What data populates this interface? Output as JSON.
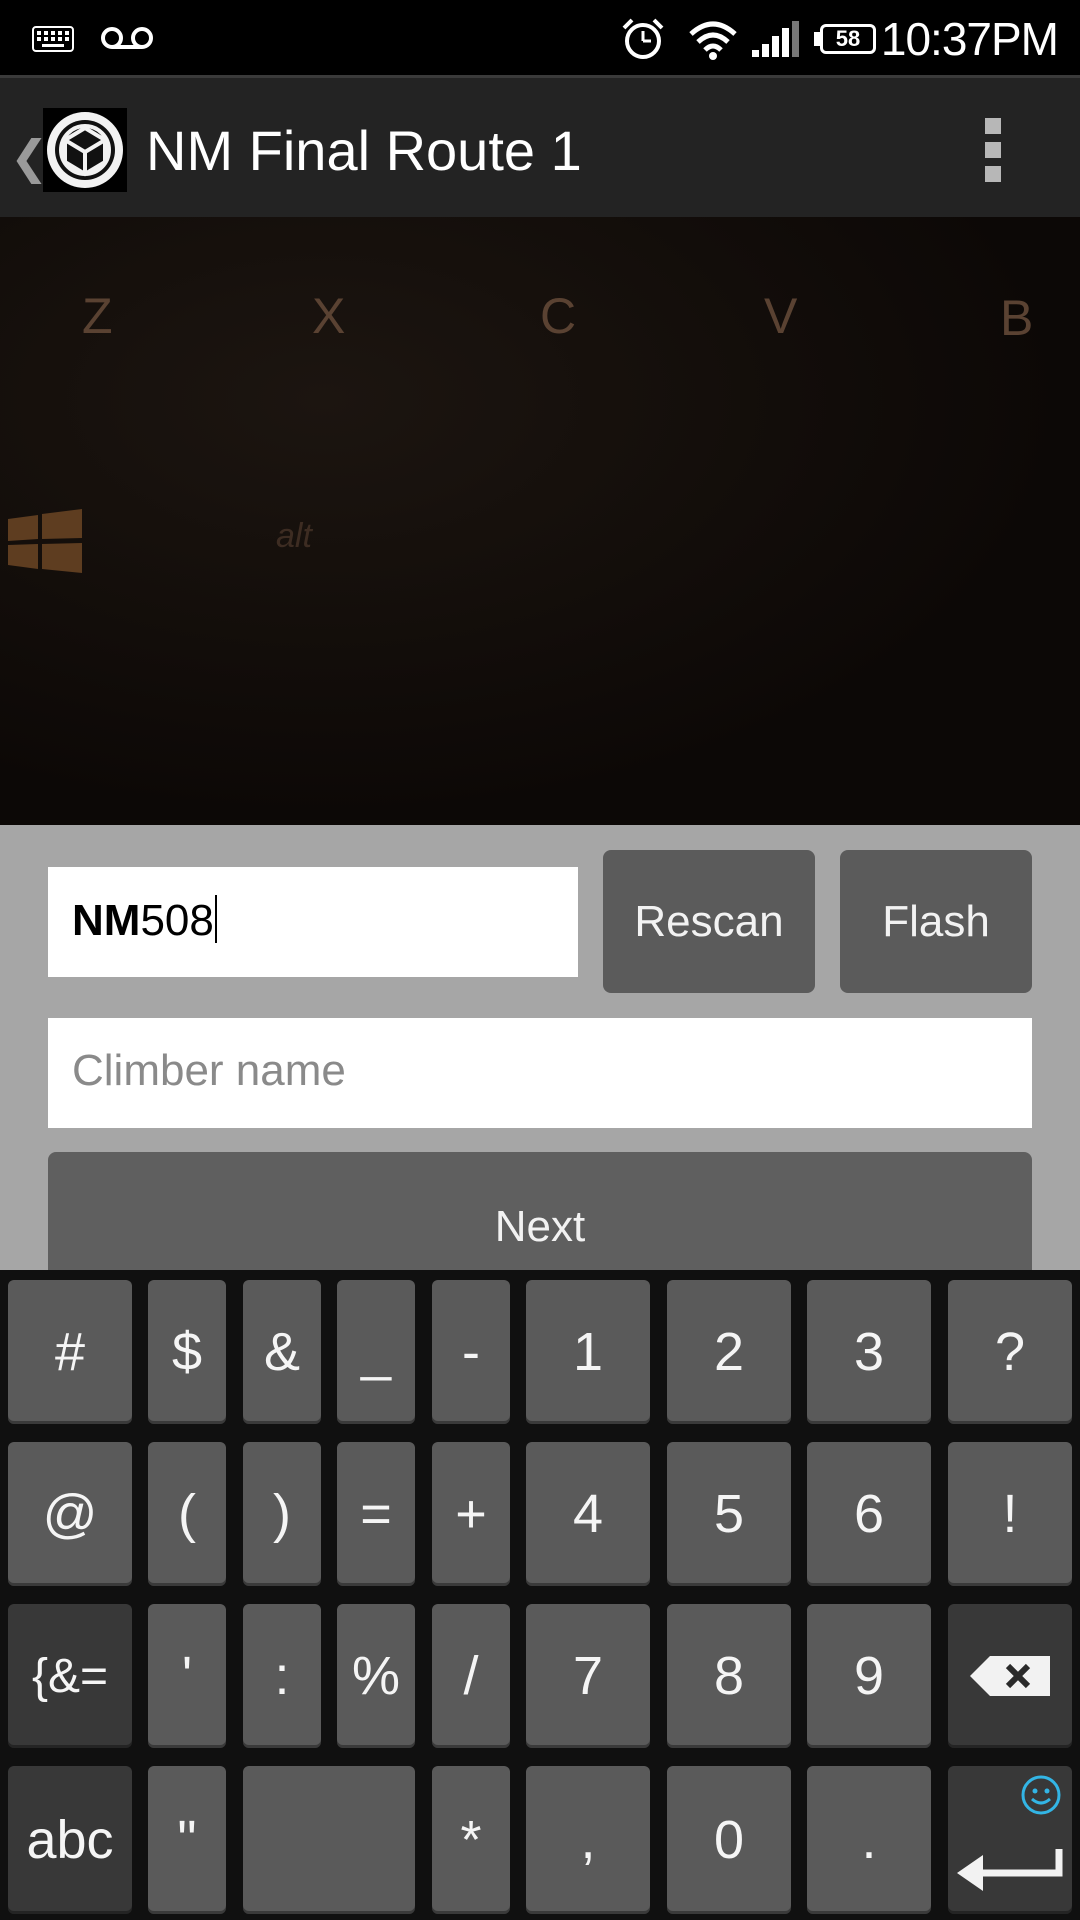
{
  "status_bar": {
    "time": "10:37PM",
    "battery_level": "58",
    "icons": [
      "keyboard-icon",
      "voicemail-icon",
      "alarm-icon",
      "wifi-icon",
      "signal-icon",
      "battery-icon"
    ]
  },
  "action_bar": {
    "back_glyph": "❮",
    "title": "NM Final Route 1",
    "menu_icon": "overflow-menu-icon"
  },
  "camera_preview": {
    "visible_keys": [
      "Z",
      "X",
      "C",
      "V",
      "B",
      "alt"
    ]
  },
  "form": {
    "code_prefix": "NM",
    "code_value": "508",
    "rescan_label": "Rescan",
    "flash_label": "Flash",
    "climber_placeholder": "Climber name",
    "climber_value": "",
    "next_label": "Next"
  },
  "keyboard": {
    "row1": [
      "#",
      "$",
      "&",
      "_",
      "-",
      "1",
      "2",
      "3",
      "?"
    ],
    "row2": [
      "@",
      "(",
      ")",
      "=",
      "+",
      "4",
      "5",
      "6",
      "!"
    ],
    "row3": [
      "{&=",
      "'",
      ":",
      "%",
      "/",
      "7",
      "8",
      "9"
    ],
    "row4": [
      "abc",
      "\"",
      "",
      "*",
      ",",
      "0",
      "."
    ],
    "backspace_icon": "backspace-icon",
    "enter_icon": "enter-icon",
    "emoji_icon": "smiley-icon"
  },
  "colors": {
    "panel_bg": "#a6a6a6",
    "button_bg": "#5b5b5b",
    "action_bar_bg": "#232323",
    "emoji_accent": "#33b5e5"
  }
}
